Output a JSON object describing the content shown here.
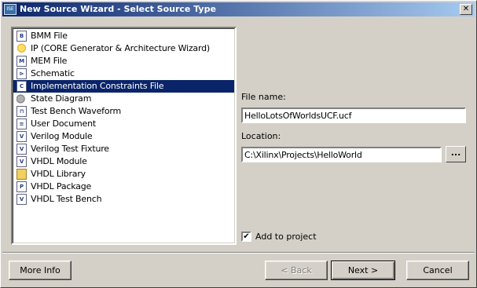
{
  "window": {
    "title": "New Source Wizard - Select Source Type",
    "icon_name": "ise-app-icon",
    "close_glyph": "✕"
  },
  "source_types": [
    {
      "label": "BMM File",
      "icon": "document-icon",
      "glyph": "B"
    },
    {
      "label": "IP (CORE Generator & Architecture Wizard)",
      "icon": "lightbulb-icon",
      "glyph": ""
    },
    {
      "label": "MEM File",
      "icon": "document-icon",
      "glyph": "M"
    },
    {
      "label": "Schematic",
      "icon": "schematic-icon",
      "glyph": "⊳"
    },
    {
      "label": "Implementation Constraints File",
      "icon": "constraints-icon",
      "glyph": "C",
      "selected": true
    },
    {
      "label": "State Diagram",
      "icon": "state-diagram-icon",
      "glyph": ""
    },
    {
      "label": "Test Bench Waveform",
      "icon": "waveform-icon",
      "glyph": "⊓"
    },
    {
      "label": "User Document",
      "icon": "document-icon",
      "glyph": "≡"
    },
    {
      "label": "Verilog Module",
      "icon": "verilog-icon",
      "glyph": "V"
    },
    {
      "label": "Verilog Test Fixture",
      "icon": "verilog-icon",
      "glyph": "V"
    },
    {
      "label": "VHDL Module",
      "icon": "vhdl-icon",
      "glyph": "V"
    },
    {
      "label": "VHDL Library",
      "icon": "folder-icon",
      "glyph": ""
    },
    {
      "label": "VHDL Package",
      "icon": "vhdl-icon",
      "glyph": "P"
    },
    {
      "label": "VHDL Test Bench",
      "icon": "vhdl-icon",
      "glyph": "V"
    }
  ],
  "file_name": {
    "label": "File name:",
    "value": "HelloLotsOfWorldsUCF.ucf"
  },
  "location": {
    "label": "Location:",
    "value": "C:\\Xilinx\\Projects\\HelloWorld",
    "browse_label": "..."
  },
  "add_to_project": {
    "label": "Add to project",
    "checked": true,
    "check_glyph": "✔"
  },
  "buttons": {
    "more_info": "More Info",
    "back": "< Back",
    "next": "Next >",
    "cancel": "Cancel"
  },
  "colors": {
    "selection": "#0a246a",
    "dialog_face": "#d4d0c8"
  }
}
